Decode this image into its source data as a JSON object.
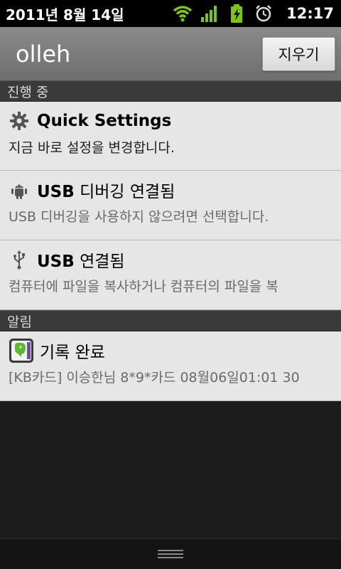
{
  "status_bar": {
    "date": "2011년 8월 14일",
    "time": "12:17",
    "icons": [
      "wifi-icon",
      "signal-icon",
      "battery-charging-icon",
      "alarm-clock-icon"
    ],
    "accent_color": "#7ac70c"
  },
  "carrier": {
    "name": "olleh",
    "clear_label": "지우기"
  },
  "sections": {
    "ongoing": "진행 중",
    "notifications": "알림"
  },
  "ongoing": [
    {
      "icon": "gear-icon",
      "title": "Quick Settings",
      "text": "지금 바로 설정을 변경합니다."
    },
    {
      "icon": "android-bug-icon",
      "title_bold": "USB",
      "title_rest": " 디버깅 연결됨",
      "text": "USB 디버깅을 사용하지 않으려면 선택합니다."
    },
    {
      "icon": "usb-icon",
      "title_bold": "USB",
      "title_rest": " 연결됨",
      "text": "컴퓨터에 파일을 복사하거나 컴퓨터의 파일을 복"
    }
  ],
  "notifications": [
    {
      "icon": "evernote-app-icon",
      "title": "기록 완료",
      "text": "[KB카드] 이승한님 8*9*카드 08월06일01:01 30"
    }
  ]
}
